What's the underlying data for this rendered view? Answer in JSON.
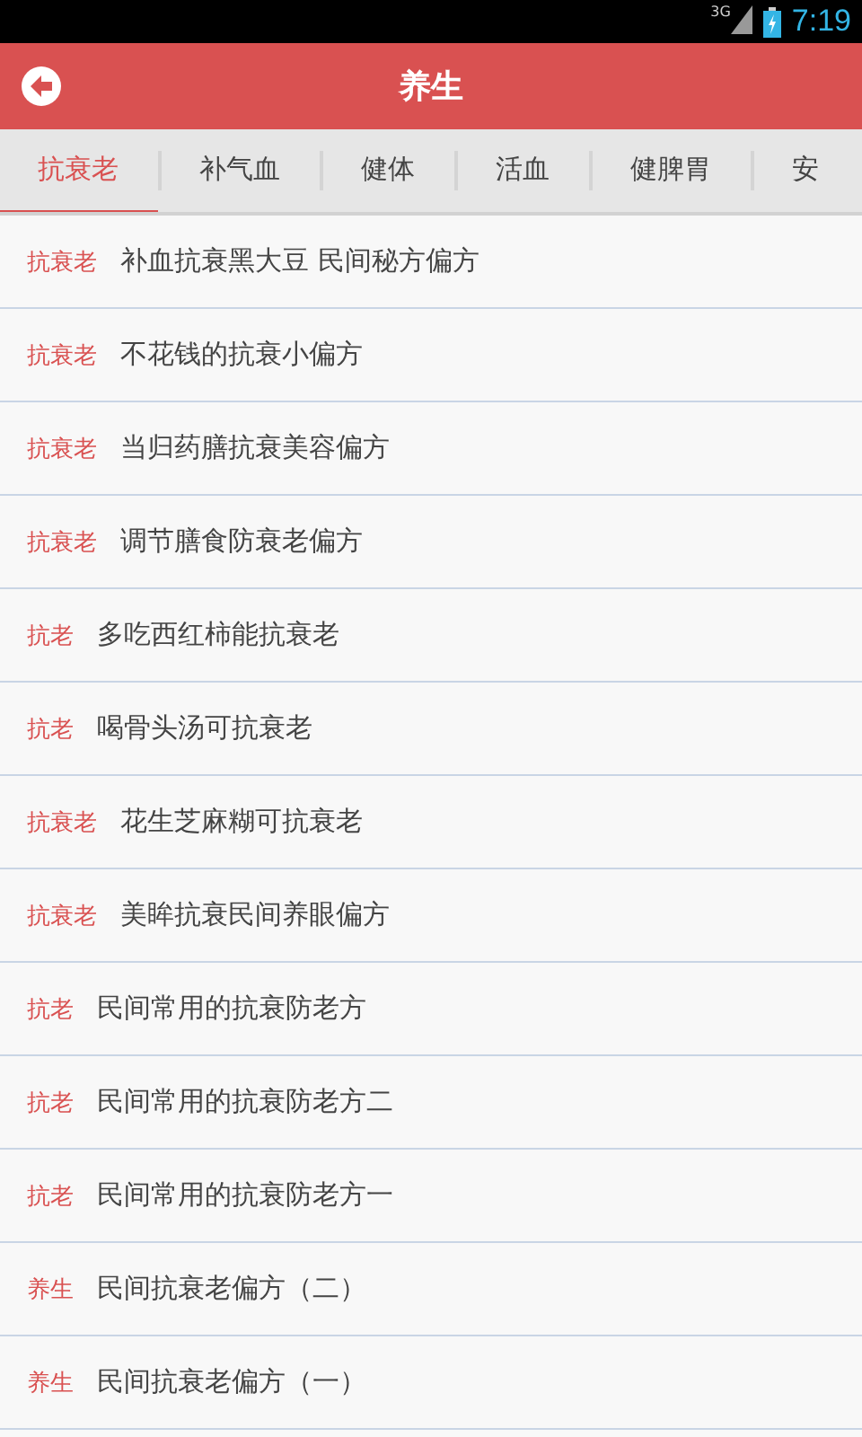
{
  "status_bar": {
    "network": "3G",
    "time": "7:19"
  },
  "header": {
    "title": "养生"
  },
  "tabs": [
    {
      "label": "抗衰老",
      "selected": true
    },
    {
      "label": "补气血",
      "selected": false
    },
    {
      "label": "健体",
      "selected": false
    },
    {
      "label": "活血",
      "selected": false
    },
    {
      "label": "健脾胃",
      "selected": false
    },
    {
      "label": "安",
      "selected": false
    }
  ],
  "articles": [
    {
      "tag": "抗衰老",
      "title": "补血抗衰黑大豆 民间秘方偏方"
    },
    {
      "tag": "抗衰老",
      "title": "不花钱的抗衰小偏方"
    },
    {
      "tag": "抗衰老",
      "title": "当归药膳抗衰美容偏方"
    },
    {
      "tag": "抗衰老",
      "title": "调节膳食防衰老偏方"
    },
    {
      "tag": "抗老",
      "title": "多吃西红柿能抗衰老"
    },
    {
      "tag": "抗老",
      "title": "喝骨头汤可抗衰老"
    },
    {
      "tag": "抗衰老",
      "title": "花生芝麻糊可抗衰老"
    },
    {
      "tag": "抗衰老",
      "title": "美眸抗衰民间养眼偏方"
    },
    {
      "tag": "抗老",
      "title": "民间常用的抗衰防老方"
    },
    {
      "tag": "抗老",
      "title": "民间常用的抗衰防老方二"
    },
    {
      "tag": "抗老",
      "title": "民间常用的抗衰防老方一"
    },
    {
      "tag": "养生",
      "title": "民间抗衰老偏方（二）"
    },
    {
      "tag": "养生",
      "title": "民间抗衰老偏方（一）"
    }
  ]
}
